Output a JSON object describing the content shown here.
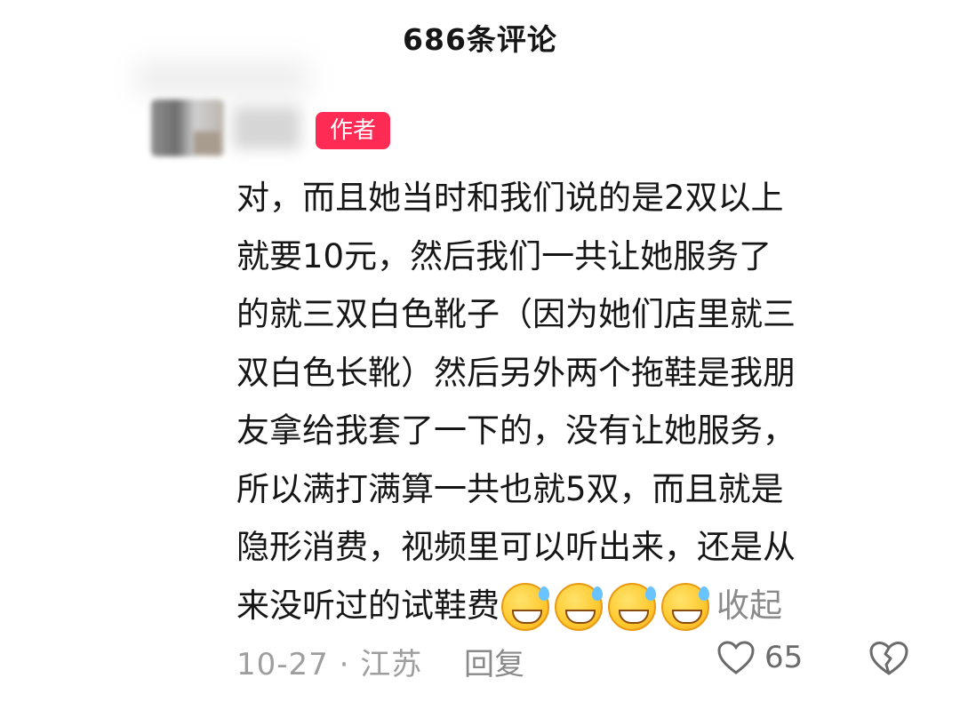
{
  "header": {
    "title": "686条评论"
  },
  "comment": {
    "badge": "作者",
    "lines": [
      "对，而且她当时和我们说的是2双以上",
      "就要10元，然后我们一共让她服务了",
      "的就三双白色靴子（因为她们店里就三",
      "双白色长靴）然后另外两个拖鞋是我朋",
      "友拿给我套了一下的，没有让她服务，",
      "所以满打满算一共也就5双，而且就是",
      "隐形消费，视频里可以听出来，还是从",
      "来没听过的试鞋费"
    ],
    "emoji_count": 4,
    "emoji_name": "grinning-sweat-emoji",
    "collapse_label": "收起"
  },
  "footer": {
    "meta": "10-27 · 江苏",
    "reply_label": "回复",
    "like_count": "65"
  },
  "colors": {
    "badge": "#fe2c55",
    "text": "#161616",
    "muted": "#9e9e9e"
  }
}
